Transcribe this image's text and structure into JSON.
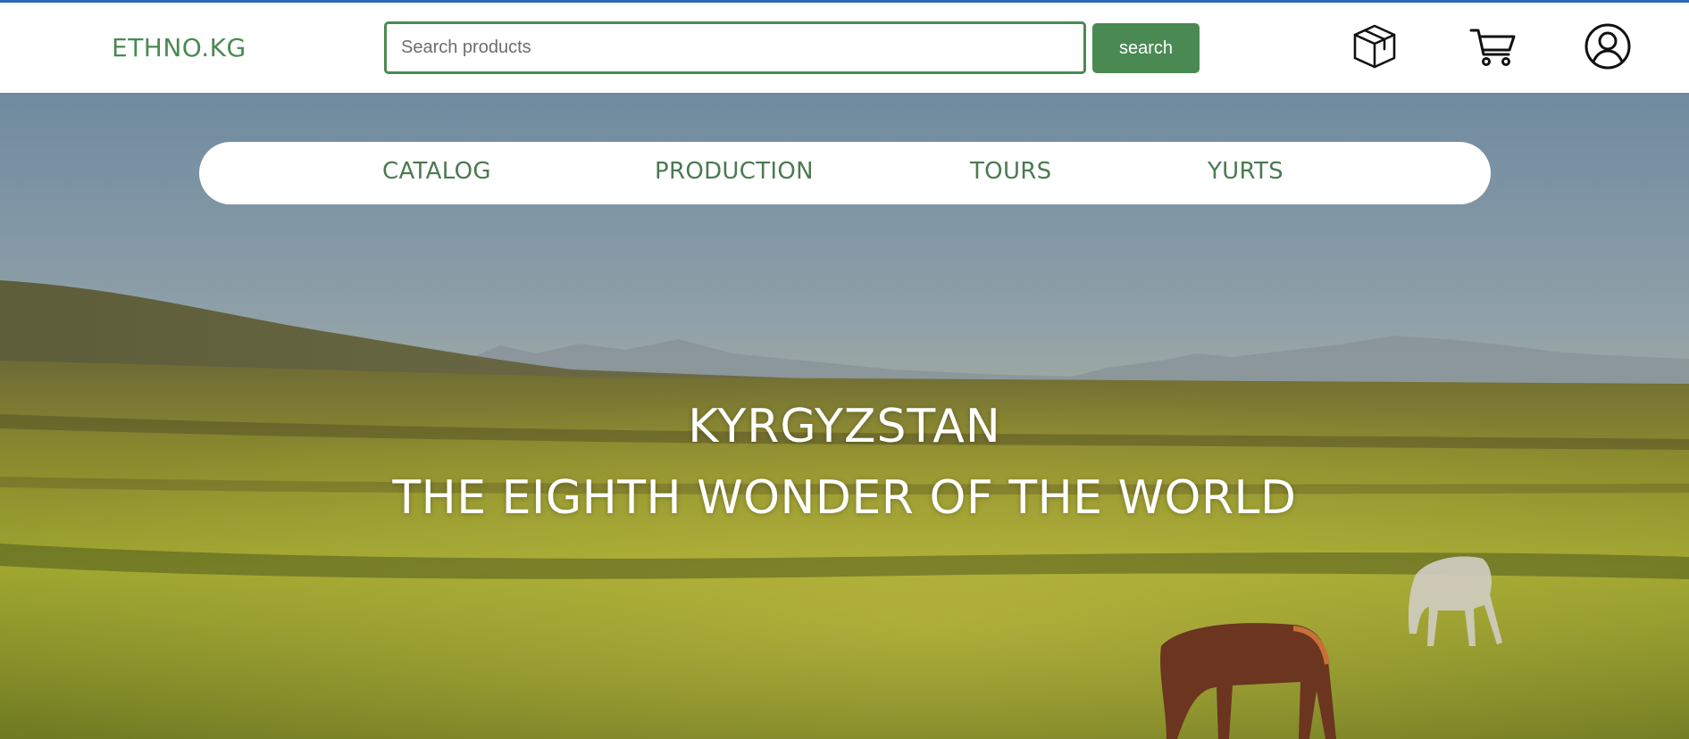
{
  "header": {
    "logo": "ETHNO.KG",
    "search": {
      "placeholder": "Search products",
      "value": "",
      "button_label": "search"
    },
    "icons": [
      "package-icon",
      "cart-icon",
      "user-account-icon"
    ]
  },
  "nav": {
    "items": [
      {
        "label": "CATALOG"
      },
      {
        "label": "PRODUCTION"
      },
      {
        "label": "TOURS"
      },
      {
        "label": "YURTS"
      }
    ]
  },
  "hero": {
    "title": "KYRGYZSTAN",
    "subtitle": "THE EIGHTH WONDER OF THE WORLD"
  },
  "colors": {
    "brand_green": "#4a8a52",
    "top_accent": "#2f68b8"
  }
}
